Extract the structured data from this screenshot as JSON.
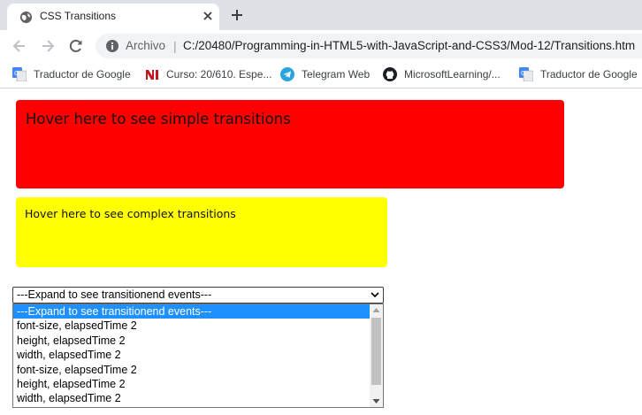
{
  "browser": {
    "tab": {
      "title": "CSS Transitions",
      "favicon": "globe-icon",
      "close_icon": "close-icon"
    },
    "new_tab_icon": "plus-icon",
    "toolbar": {
      "back_icon": "back-arrow-icon",
      "forward_icon": "forward-arrow-icon",
      "reload_icon": "reload-icon",
      "site_info_icon": "info-icon",
      "site_chip": "Archivo",
      "separator": "|",
      "url": "C:/20480/Programming-in-HTML5-with-JavaScript-and-CSS3/Mod-12/Transitions.htm"
    },
    "bookmarks": [
      {
        "label": "Traductor de Google",
        "icon": "google-translate-icon"
      },
      {
        "label": "Curso: 20/610. Espe...",
        "icon": "ni-logo-icon"
      },
      {
        "label": "Telegram Web",
        "icon": "telegram-icon"
      },
      {
        "label": "MicrosoftLearning/...",
        "icon": "github-icon"
      },
      {
        "label": "Traductor de Google",
        "icon": "google-translate-icon"
      }
    ]
  },
  "page": {
    "simple_box": {
      "text": "Hover here to see simple transitions",
      "color": "#ff0000"
    },
    "complex_box": {
      "text": "Hover here to see complex transitions",
      "color": "#ffff00"
    },
    "events_select": {
      "selected_value": "---Expand to see transitionend events---",
      "options": [
        "---Expand to see transitionend events---",
        "font-size, elapsedTime 2",
        "height, elapsedTime 2",
        "width, elapsedTime 2",
        "font-size, elapsedTime 2",
        "height, elapsedTime 2",
        "width, elapsedTime 2"
      ],
      "highlight_color": "#1e90ff"
    }
  },
  "colors": {
    "tabstrip": "#dee1e6",
    "omnibox": "#f1f3f4"
  }
}
